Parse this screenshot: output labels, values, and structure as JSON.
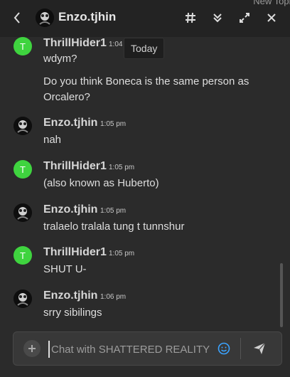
{
  "header": {
    "title": "Enzo.tjhin",
    "peek_text": "New Topic"
  },
  "tooltip": "Today",
  "messages": [
    {
      "name": "ThrillHider1",
      "time": "1:04",
      "lines": [
        "wdym?",
        "Do you think Boneca is the same person as",
        "Orcalero?"
      ],
      "avatar": "T"
    },
    {
      "name": "Enzo.tjhin",
      "time": "1:05 pm",
      "lines": [
        "nah"
      ]
    },
    {
      "name": "ThrillHider1",
      "time": "1:05 pm",
      "lines": [
        "(also known as Huberto)"
      ],
      "avatar": "T"
    },
    {
      "name": "Enzo.tjhin",
      "time": "1:05 pm",
      "lines": [
        "tralaelo tralala tung t tunnshur"
      ]
    },
    {
      "name": "ThrillHider1",
      "time": "1:05 pm",
      "lines": [
        "SHUT U-"
      ],
      "avatar": "T"
    },
    {
      "name": "Enzo.tjhin",
      "time": "1:06 pm",
      "lines": [
        "srry sibilings"
      ]
    }
  ],
  "composer": {
    "placeholder": "Chat with SHATTERED REALITY"
  },
  "colors": {
    "accent": "#3ba3ff",
    "online": "#3fd43f",
    "bg": "#2b2b2b"
  }
}
